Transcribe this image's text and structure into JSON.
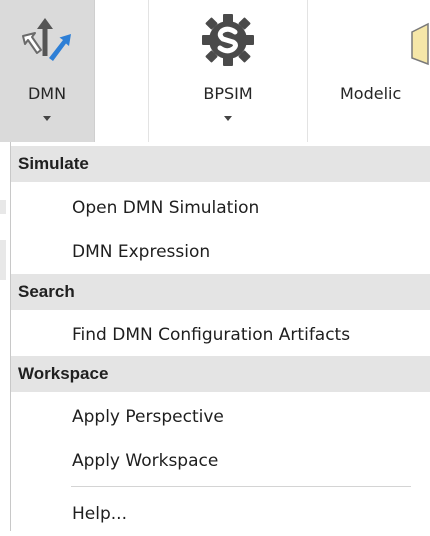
{
  "ribbon": {
    "dmn": {
      "label": "DMN"
    },
    "bpsim": {
      "label": "BPSIM"
    },
    "modelica": {
      "label": "Modelic"
    }
  },
  "menu": {
    "sections": [
      {
        "header": "Simulate",
        "items": [
          "Open DMN Simulation",
          "DMN Expression"
        ]
      },
      {
        "header": "Search",
        "items": [
          "Find DMN Configuration Artifacts"
        ]
      },
      {
        "header": "Workspace",
        "items": [
          "Apply Perspective",
          "Apply Workspace"
        ]
      }
    ],
    "help": "Help..."
  },
  "colors": {
    "header_bg": "#e4e4e4",
    "selected_button_bg": "#dadada",
    "dmn_arrow_blue": "#2e7fd6",
    "gear_gray": "#4a4a4a"
  },
  "icons": {
    "dmn": "dmn-arrows-icon",
    "bpsim": "bpsim-gear-icon",
    "modelica": "modelica-doc-icon"
  }
}
